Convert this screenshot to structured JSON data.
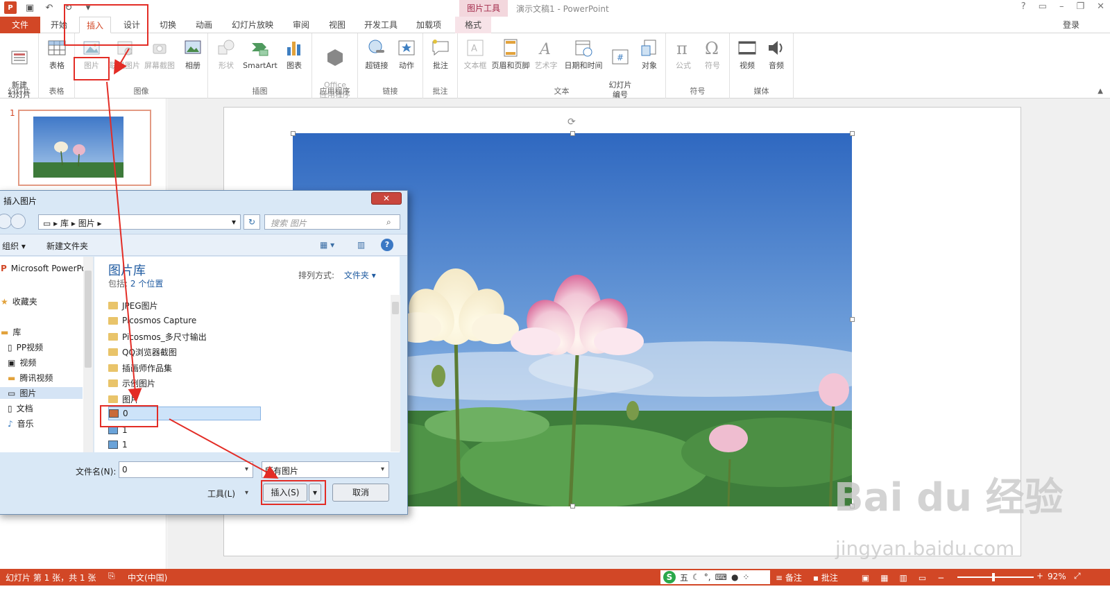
{
  "app": {
    "title": "演示文稿1 - PowerPoint",
    "context_tab_header": "图片工具",
    "login": "登录"
  },
  "tabs": [
    "文件",
    "开始",
    "插入",
    "设计",
    "切换",
    "动画",
    "幻灯片放映",
    "审阅",
    "视图",
    "开发工具",
    "加载项",
    "格式"
  ],
  "ribbon": {
    "groups": [
      {
        "label": "幻灯片",
        "buttons": [
          "新建\n幻灯片"
        ]
      },
      {
        "label": "表格",
        "buttons": [
          "表格"
        ]
      },
      {
        "label": "图像",
        "buttons": [
          "图片",
          "联机图片",
          "屏幕截图",
          "相册"
        ]
      },
      {
        "label": "插图",
        "buttons": [
          "形状",
          "SmartArt",
          "图表"
        ]
      },
      {
        "label": "应用程序",
        "buttons": [
          "Office\n应用程序"
        ]
      },
      {
        "label": "链接",
        "buttons": [
          "超链接",
          "动作"
        ]
      },
      {
        "label": "批注",
        "buttons": [
          "批注"
        ]
      },
      {
        "label": "文本",
        "buttons": [
          "文本框",
          "页眉和页脚",
          "艺术字",
          "日期和时间",
          "幻灯片\n编号",
          "对象"
        ]
      },
      {
        "label": "符号",
        "buttons": [
          "公式",
          "符号"
        ]
      },
      {
        "label": "媒体",
        "buttons": [
          "视频",
          "音频"
        ]
      }
    ]
  },
  "thumbnails": {
    "slide_number": "1"
  },
  "dialog": {
    "title": "插入图片",
    "address": [
      "库",
      "图片"
    ],
    "search_placeholder": "搜索 图片",
    "toolbar": {
      "organize": "组织 ▾",
      "new_folder": "新建文件夹"
    },
    "nav_items": [
      "Microsoft PowerPoint",
      "收藏夹",
      "库",
      "PP视频",
      "视频",
      "腾讯视频",
      "图片",
      "文档",
      "音乐"
    ],
    "library_title": "图片库",
    "library_sub_prefix": "包括:",
    "library_sub_link": "2 个位置",
    "sort_label": "排列方式:",
    "sort_value": "文件夹 ▾",
    "files": [
      "JPEG图片",
      "Picosmos Capture",
      "Picosmos_多尺寸输出",
      "QQ浏览器截图",
      "插画师作品集",
      "示例图片",
      "图片",
      "0",
      "1",
      "1"
    ],
    "filename_label": "文件名(N):",
    "filename_value": "0",
    "filetype_value": "所有图片",
    "tools_label": "工具(L)",
    "insert_button": "插入(S)",
    "cancel_button": "取消"
  },
  "status": {
    "slide_info": "幻灯片 第 1 张，共 1 张",
    "language": "中文(中国)",
    "ime_text": "五",
    "notes": "备注",
    "comments": "批注",
    "zoom": "92%"
  },
  "watermark": {
    "main": "Bai du 经验",
    "sub": "jingyan.baidu.com"
  },
  "colors": {
    "accent": "#d24726",
    "annotation": "#e32c25",
    "dialog_bg": "#d9e8f6"
  }
}
